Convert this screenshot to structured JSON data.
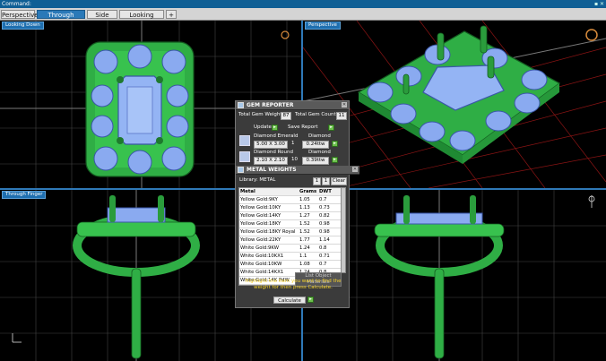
{
  "command_bar": {
    "label": "Command:",
    "right_icon": "window-controls"
  },
  "tabs": [
    {
      "label": "Perspective",
      "active": false
    },
    {
      "label": "Through Finger",
      "active": true
    },
    {
      "label": "Side View",
      "active": false
    },
    {
      "label": "Looking Down",
      "active": false
    },
    {
      "label": "+",
      "active": false
    }
  ],
  "viewports": {
    "top_left": "Looking Down",
    "top_right": "Perspective",
    "bottom_left": "Through Finger"
  },
  "gem_reporter": {
    "title": "GEM REPORTER",
    "total_weight_label": "Total Gem Weight",
    "total_weight_value": "87",
    "total_count_label": "Total Gem Count",
    "total_count_value": "11",
    "update_label": "Update",
    "save_label": "Save Report",
    "gems": [
      {
        "name": "Diamond Emerald",
        "size": "5.00 X 3.00",
        "type": "Diamond",
        "count": "1",
        "weight": "0.24ttw"
      },
      {
        "name": "Diamond Round",
        "size": "2.10 X 2.10",
        "type": "Diamond",
        "count": "10",
        "weight": "0.39ttw"
      }
    ]
  },
  "metal_weights": {
    "title": "METAL WEIGHTS",
    "library_label": "Library: METAL",
    "num_a": "1",
    "num_b": "1",
    "clear_label": "Clear",
    "columns": {
      "metal": "Metal",
      "grams": "Grams",
      "dwt": "DWT"
    },
    "rows": [
      {
        "metal": "Yellow Gold:9KY",
        "grams": "1.05",
        "dwt": "0.7"
      },
      {
        "metal": "Yellow Gold:10KY",
        "grams": "1.13",
        "dwt": "0.73"
      },
      {
        "metal": "Yellow Gold:14KY",
        "grams": "1.27",
        "dwt": "0.82"
      },
      {
        "metal": "Yellow Gold:18KY",
        "grams": "1.52",
        "dwt": "0.98"
      },
      {
        "metal": "Yellow Gold:18KY Royal",
        "grams": "1.52",
        "dwt": "0.98"
      },
      {
        "metal": "Yellow Gold:22KY",
        "grams": "1.77",
        "dwt": "1.14"
      },
      {
        "metal": "White Gold:9KW",
        "grams": "1.24",
        "dwt": "0.8"
      },
      {
        "metal": "White Gold:10KX1",
        "grams": "1.1",
        "dwt": "0.71"
      },
      {
        "metal": "White Gold:10KW",
        "grams": "1.08",
        "dwt": "0.7"
      },
      {
        "metal": "White Gold:14KX1",
        "grams": "1.24",
        "dwt": "0.8"
      },
      {
        "metal": "White Gold:14K PdW",
        "grams": "1.42",
        "dwt": "0.91"
      }
    ],
    "list_object_label": "List Object Materials",
    "hint": "Highlight the item you want to find the weight for then press Calculate.",
    "calculate_label": "Calculate"
  },
  "colors": {
    "metal_green": "#3fbf55",
    "gem_blue": "#8aaaf0",
    "grid_line": "#5a5a5a",
    "ui_accent": "#2b79b8"
  }
}
